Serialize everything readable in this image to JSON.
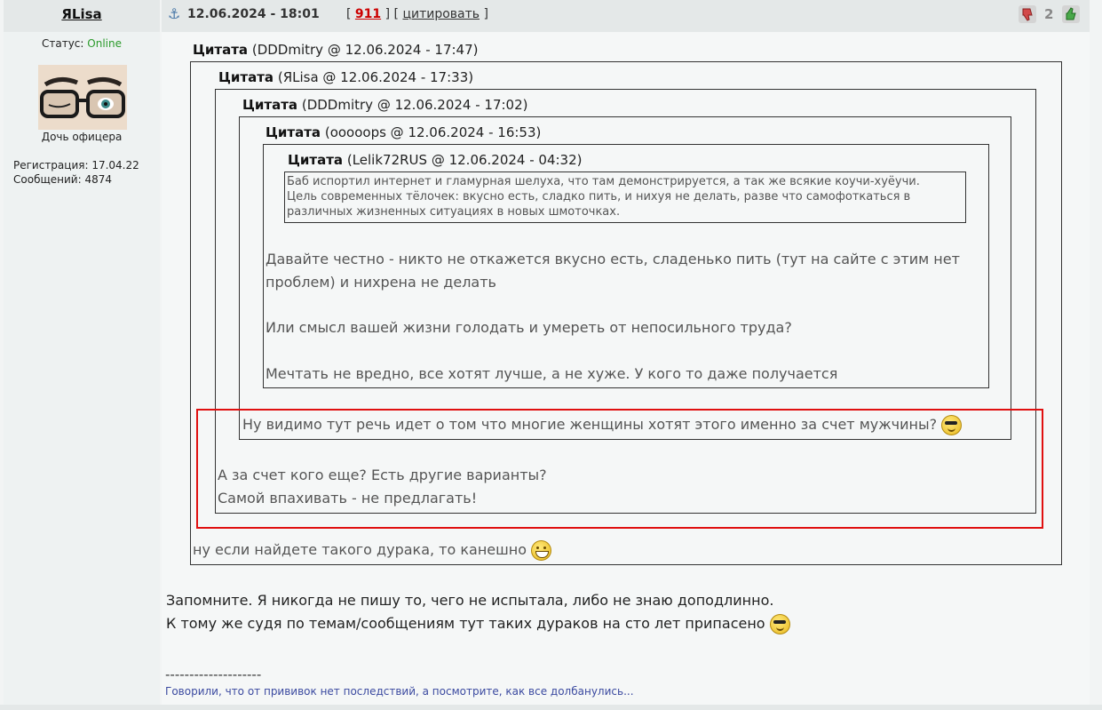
{
  "author": {
    "name": "ЯLisa",
    "status_label": "Статус:",
    "status_value": "Online",
    "rank": "Дочь офицера",
    "registration": "Регистрация: 17.04.22",
    "posts": "Сообщений: 4874"
  },
  "post_header": {
    "date": "12.06.2024 - 18:01",
    "bracket_open": "[",
    "post_number": "911",
    "bracket_mid": "] [",
    "quote_label": "цитировать",
    "bracket_close": "]",
    "rating": "2"
  },
  "quotes": [
    {
      "label": "Цитата",
      "meta": "(DDDmitry @ 12.06.2024 - 17:47)"
    },
    {
      "label": "Цитата",
      "meta": "(ЯLisa @ 12.06.2024 - 17:33)"
    },
    {
      "label": "Цитата",
      "meta": "(DDDmitry @ 12.06.2024 - 17:02)"
    },
    {
      "label": "Цитата",
      "meta": "(ooooops @ 12.06.2024 - 16:53)"
    },
    {
      "label": "Цитата",
      "meta": "(Lelik72RUS @ 12.06.2024 - 04:32)"
    }
  ],
  "innermost_text": [
    "Баб испортил интернет и гламурная шелуха, что там демонстрируется, а так же всякие коучи-хуёучи.",
    "Цель современных тёлочек: вкусно есть, сладко пить,  и нихуя не делать, разве что самофоткаться в",
    "различных жизненных ситуациях в новых шмоточках."
  ],
  "level4_text": [
    "Давайте честно - никто не откажется вкусно есть, сладенько пить (тут на сайте с этим нет",
    "проблем) и нихрена не делать",
    "Или смысл вашей жизни голодать и умереть от непосильного труда?",
    "Мечтать не вредно, все хотят лучше, а не хуже. У кого то даже получается"
  ],
  "level3_text": "Ну видимо тут речь идет о том что многие женщины хотят этого именно за счет мужчины?",
  "level2_text": [
    "А за счет кого еще? Есть другие варианты?",
    "Самой впахивать - не предлагать!"
  ],
  "level1_text": "ну если найдете такого дурака, то канешно",
  "main_text": [
    "Запомните. Я никогда не пишу то, чего не испытала, либо не знаю доподлинно.",
    "К тому же судя по темам/сообщениям тут таких дураков на сто лет припасено"
  ],
  "signature": {
    "separator": "--------------------",
    "text": "Говорили, что от прививок нет последствий, а посмотрите, как все долбанулись..."
  },
  "colors": {
    "online": "#2a9a2a",
    "post_number": "#c00000",
    "highlight": "#e01010",
    "signature": "#3b4aa0"
  },
  "icons": [
    "anchor-icon",
    "thumb-down-icon",
    "thumb-up-icon",
    "cool-smiley-icon",
    "grin-smiley-icon"
  ]
}
